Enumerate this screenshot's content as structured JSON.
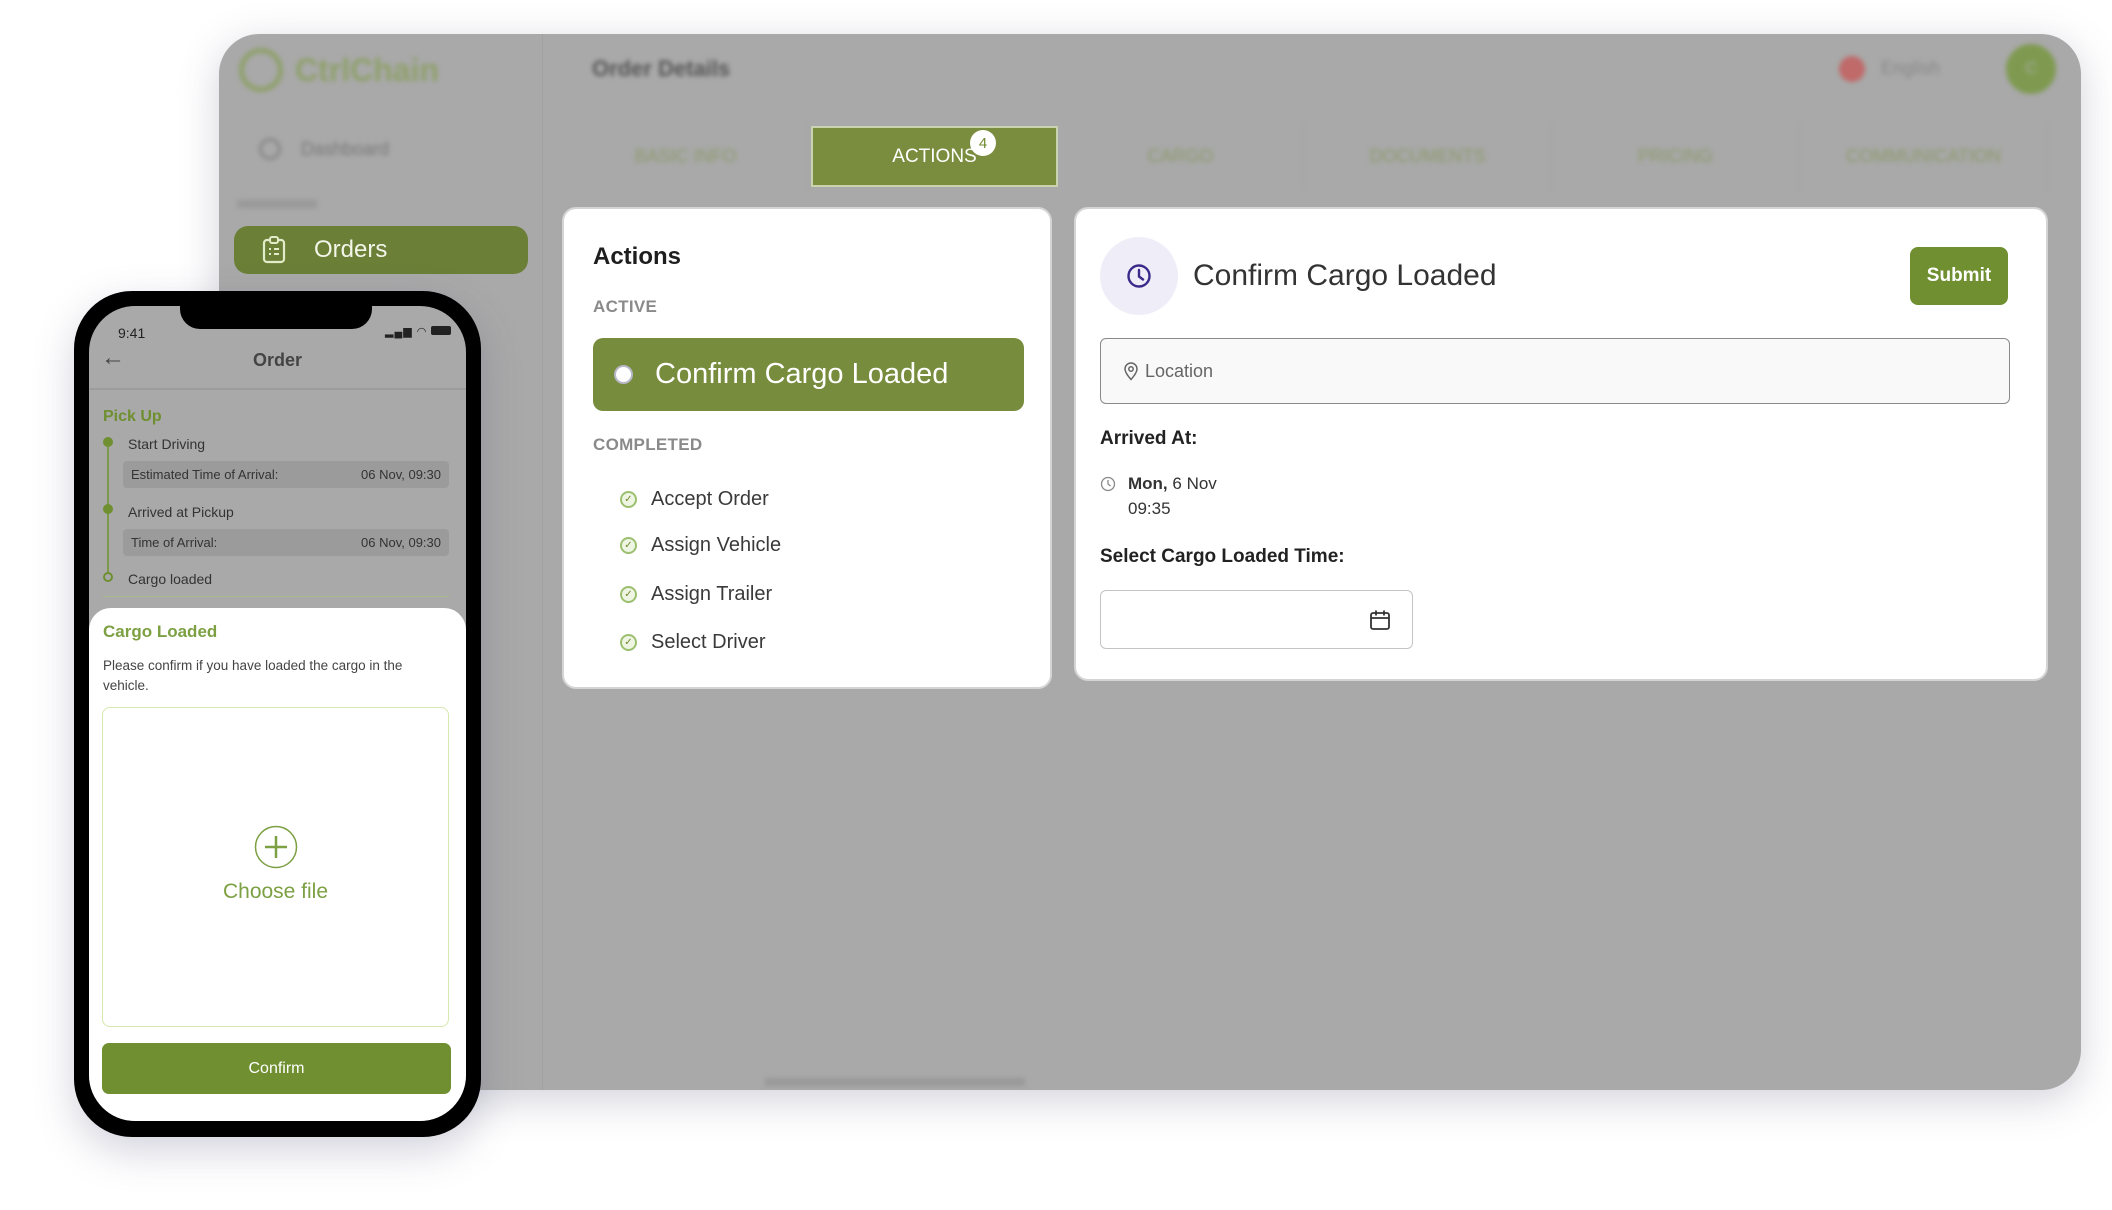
{
  "app": {
    "brand": "CtrlChain",
    "page_title": "Order Details",
    "language": "English",
    "avatar_initial": "C"
  },
  "sidebar": {
    "items": [
      {
        "label": "Dashboard",
        "icon": "dashboard-icon"
      },
      {
        "label": "Orders",
        "icon": "clipboard-icon",
        "active": true
      }
    ]
  },
  "tabs": [
    {
      "label": "BASIC INFO"
    },
    {
      "label": "ACTIONS",
      "badge": "4",
      "active": true
    },
    {
      "label": "CARGO"
    },
    {
      "label": "DOCUMENTS"
    },
    {
      "label": "PRICING"
    },
    {
      "label": "COMMUNICATION"
    }
  ],
  "actions_panel": {
    "title": "Actions",
    "active_label": "ACTIVE",
    "active_item": "Confirm Cargo Loaded",
    "completed_label": "COMPLETED",
    "completed": [
      "Accept Order",
      "Assign Vehicle",
      "Assign Trailer",
      "Select Driver"
    ]
  },
  "detail": {
    "title": "Confirm Cargo Loaded",
    "submit": "Submit",
    "location_placeholder": "Location",
    "arrived_label": "Arrived At:",
    "arrived_day": "Mon,",
    "arrived_date": "6 Nov",
    "arrived_time": "09:35",
    "select_label": "Select Cargo Loaded Time:",
    "select_value": ""
  },
  "mobile": {
    "time": "9:41",
    "header": "Order",
    "section": "Pick Up",
    "steps": [
      {
        "label": "Start Driving",
        "info_label": "Estimated Time of Arrival:",
        "info_value": "06 Nov, 09:30"
      },
      {
        "label": "Arrived at Pickup",
        "info_label": "Time of Arrival:",
        "info_value": "06 Nov, 09:30"
      },
      {
        "label": "Cargo loaded"
      }
    ],
    "sheet": {
      "title": "Cargo Loaded",
      "text": "Please confirm if you have loaded the cargo in the vehicle.",
      "upload": "Choose file",
      "confirm": "Confirm"
    }
  },
  "colors": {
    "brand_green": "#6f8f30",
    "overlay": "#a9a9a9",
    "icon_purple": "#3b2a8a"
  }
}
